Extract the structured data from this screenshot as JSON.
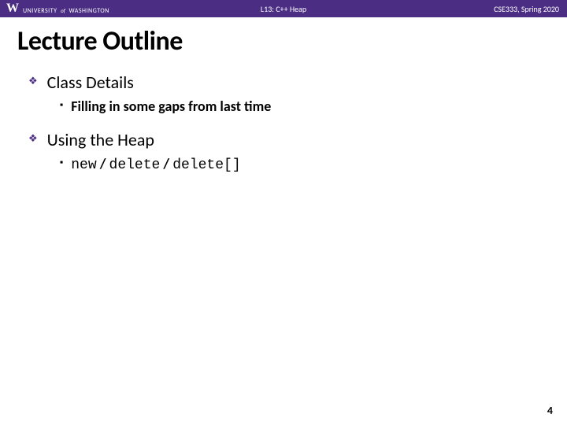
{
  "header": {
    "brand1": "UNIVERSITY",
    "brand_of": "of",
    "brand2": "WASHINGTON",
    "center": "L13:  C++ Heap",
    "right": "CSE333, Spring 2020"
  },
  "title": "Lecture Outline",
  "items": [
    {
      "label": "Class Details",
      "sub": "Filling in some gaps from last time",
      "code": false
    },
    {
      "label": "Using the Heap",
      "sub_code_parts": [
        "new",
        " / ",
        "delete",
        " / ",
        "delete[]"
      ],
      "code": true
    }
  ],
  "page_num": "4"
}
